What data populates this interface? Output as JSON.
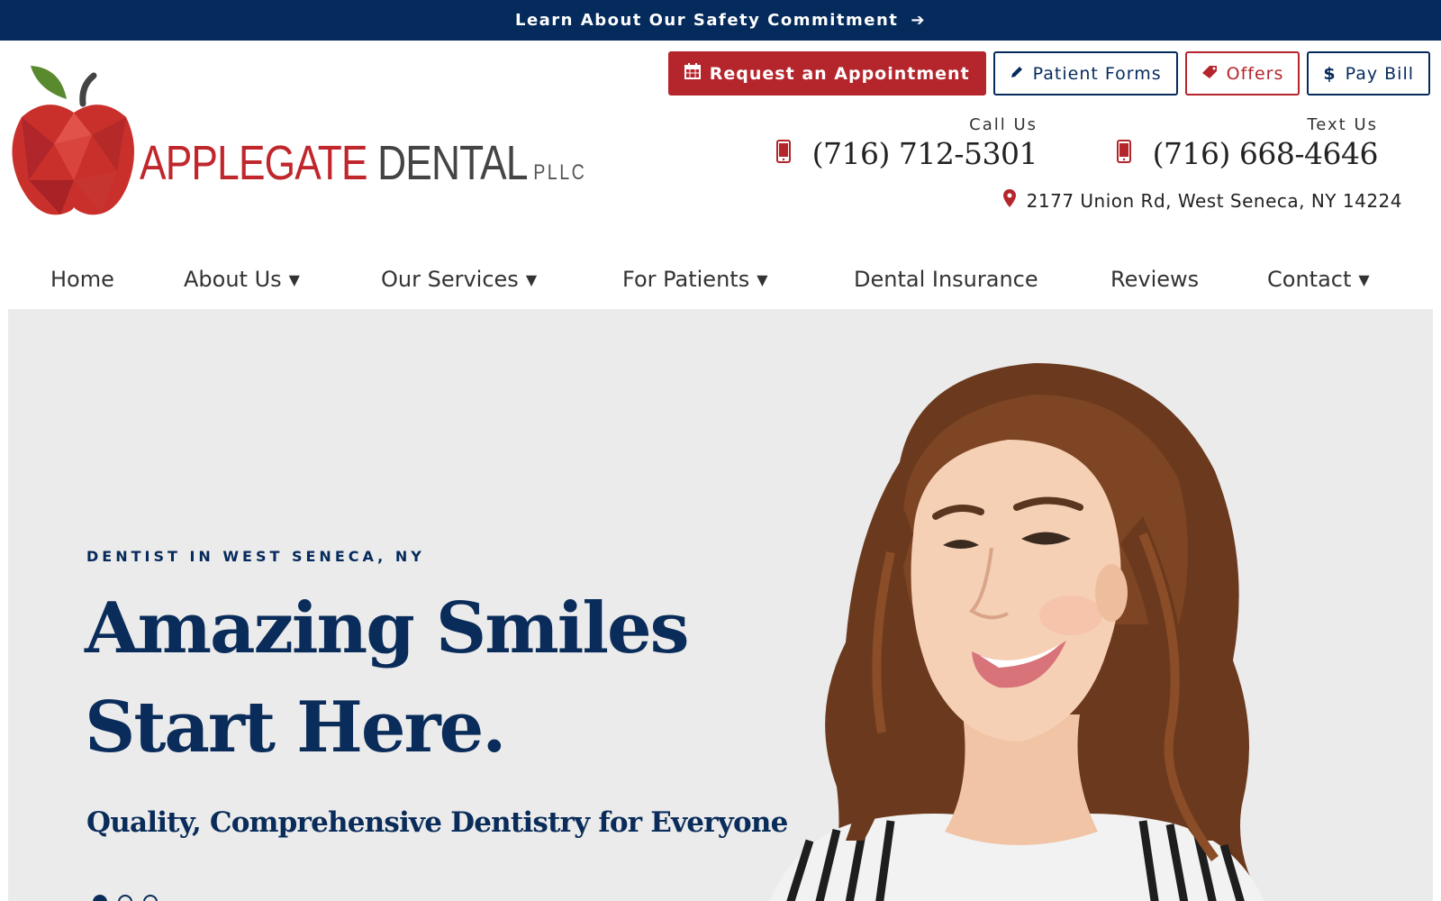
{
  "topbar": {
    "text": "Learn About Our Safety Commitment",
    "icon": "arrow-right-icon"
  },
  "logo": {
    "word1": "APPLEGATE",
    "word2": "DENTAL",
    "suffix": "PLLC"
  },
  "header_buttons": [
    {
      "label": "Request an Appointment",
      "icon": "calendar-icon"
    },
    {
      "label": "Patient Forms",
      "icon": "pencil-icon"
    },
    {
      "label": "Offers",
      "icon": "tag-icon"
    },
    {
      "label": "Pay Bill",
      "icon": "dollar-icon"
    }
  ],
  "contact": {
    "call": {
      "label": "Call Us",
      "phone": "(716) 712-5301",
      "icon": "mobile-phone-icon"
    },
    "text": {
      "label": "Text Us",
      "phone": "(716) 668-4646",
      "icon": "mobile-phone-icon"
    },
    "address": "2177 Union Rd, West Seneca, NY 14224",
    "address_icon": "map-pin-icon"
  },
  "nav": [
    {
      "label": "Home"
    },
    {
      "label": "About Us"
    },
    {
      "label": "Our Services"
    },
    {
      "label": "For Patients"
    },
    {
      "label": "Dental Insurance"
    },
    {
      "label": "Reviews"
    },
    {
      "label": "Contact"
    }
  ],
  "hero": {
    "kicker": "DENTIST IN WEST SENECA, NY",
    "title_line1": "Amazing Smiles",
    "title_line2": "Start Here.",
    "subtitle": "Quality, Comprehensive Dentistry for Everyone",
    "slide_count": 3,
    "active_slide": 1
  },
  "colors": {
    "navy": "#052a5c",
    "red": "#b5262c",
    "hero_bg": "#ebebeb"
  }
}
